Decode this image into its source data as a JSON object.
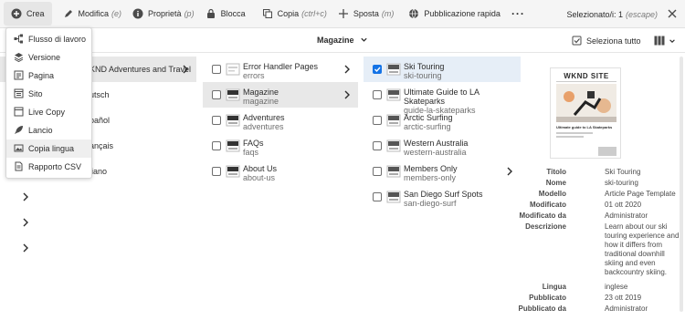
{
  "toolbar": {
    "create_label": "Crea",
    "edit_label": "Modifica",
    "edit_hint": "(e)",
    "props_label": "Proprietà",
    "props_hint": "(p)",
    "lock_label": "Blocca",
    "copy_label": "Copia",
    "copy_hint": "(ctrl+c)",
    "move_label": "Sposta",
    "move_hint": "(m)",
    "publish_label": "Pubblicazione rapida",
    "selected_text": "Selezionato/i: 1",
    "selected_hint": "(escape)"
  },
  "create_menu": {
    "items": [
      {
        "label": "Flusso di lavoro",
        "icon": "workflow-icon"
      },
      {
        "label": "Versione",
        "icon": "layers-icon"
      },
      {
        "label": "Pagina",
        "icon": "page-icon"
      },
      {
        "label": "Sito",
        "icon": "site-icon"
      },
      {
        "label": "Live Copy",
        "icon": "live-copy-icon"
      },
      {
        "label": "Lancio",
        "icon": "rocket-icon"
      },
      {
        "label": "Copia lingua",
        "icon": "language-copy-icon"
      },
      {
        "label": "Rapporto CSV",
        "icon": "report-icon"
      }
    ]
  },
  "subbar": {
    "title": "Magazine",
    "select_all": "Seleziona tutto"
  },
  "col1": {
    "items": [
      {
        "text": "KND Adventures and Travel"
      },
      {
        "text": "utsch"
      },
      {
        "text": "pañol"
      },
      {
        "text": "ançais"
      },
      {
        "text": "liano"
      }
    ]
  },
  "col2": {
    "items": [
      {
        "title": "Error Handler Pages",
        "name": "errors"
      },
      {
        "title": "Magazine",
        "name": "magazine"
      },
      {
        "title": "Adventures",
        "name": "adventures"
      },
      {
        "title": "FAQs",
        "name": "faqs"
      },
      {
        "title": "About Us",
        "name": "about-us"
      }
    ]
  },
  "col3": {
    "items": [
      {
        "title": "Ski Touring",
        "name": "ski-touring"
      },
      {
        "title": "Ultimate Guide to LA Skateparks",
        "name": "guide-la-skateparks"
      },
      {
        "title": "Arctic Surfing",
        "name": "arctic-surfing"
      },
      {
        "title": "Western Australia",
        "name": "western-australia"
      },
      {
        "title": "Members Only",
        "name": "members-only"
      },
      {
        "title": "San Diego Surf Spots",
        "name": "san-diego-surf"
      }
    ]
  },
  "preview": {
    "brand": "WKND SITE",
    "headline": "Ultimate guide to LA Skateparks"
  },
  "properties": {
    "title_k": "Titolo",
    "title_v": "Ski Touring",
    "name_k": "Nome",
    "name_v": "ski-touring",
    "model_k": "Modello",
    "model_v": "Article Page Template",
    "modified_k": "Modificato",
    "modified_v": "01 ott 2020",
    "modified_by_k": "Modificato da",
    "modified_by_v": "Administrator",
    "desc_k": "Descrizione",
    "desc_v": "Learn about our ski touring experience and how it differs from traditional downhill skiing and even backcountry skiing.",
    "lang_k": "Lingua",
    "lang_v": "inglese",
    "published_k": "Pubblicato",
    "published_v": "23 ott 2019",
    "published_by_k": "Pubblicato da",
    "published_by_v": "Administrator"
  },
  "colors": {
    "accent": "#1473e6",
    "toolbar_bg": "#f5f5f5",
    "selected_row": "#e8e8e8"
  }
}
